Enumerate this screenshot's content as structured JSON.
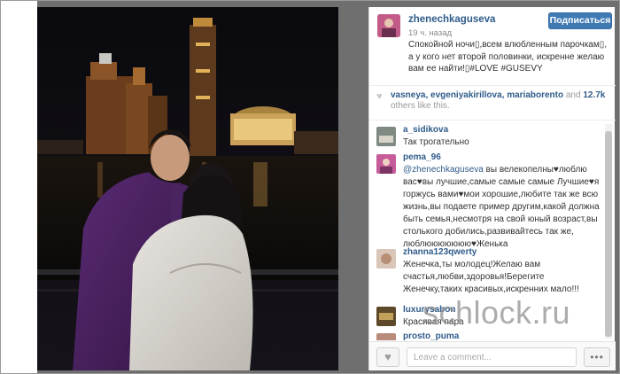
{
  "post": {
    "username": "zhenechkaguseva",
    "follow_label": "Подписаться",
    "time": "19 ч. назад",
    "caption": "Спокойной ночи▯,всем влюбленным парочкам▯, а у кого нет второй половинки, искренне желаю вам ее найти!▯#LOVE #GUSEVY"
  },
  "likes": {
    "users": "vasneya, evgeniyakirillova, mariaborento",
    "and": "and",
    "count": "12.7k",
    "rest": "others like this."
  },
  "comments": [
    {
      "user": "a_sidikova",
      "text": "Так трогательно"
    },
    {
      "user": "pema_96",
      "mention": "@zhenechkaguseva",
      "text": " вы велекопелны♥люблю вас♥вы лучшие,самые самые самые Лучшие♥я горжусь вами♥мои хорошие,любите так же всю жизнь,вы подаете пример другим,какой должна быть семья,несмотря на свой юный возраст,вы столького добились,развивайтесь так же, люблююююююю♥Женька"
    },
    {
      "user": "zhanna123qwerty",
      "text": "Женечка,ты молодец!Желаю вам счастья,любви,здоровья!Берегите Женечку,таких красивых,искренних мало!!!"
    },
    {
      "user": "luxurysabon",
      "text": "Красивая пара"
    },
    {
      "user": "prosto_puma",
      "text": ""
    }
  ],
  "footer": {
    "comment_placeholder": "Leave a comment...",
    "more_label": "•••",
    "like_icon": "heart-icon"
  },
  "watermark": "schlock.ru",
  "colors": {
    "link": "#2f5c8a",
    "follow_button": "#3f7ab5",
    "photo_bg": "#0b0a0d"
  }
}
